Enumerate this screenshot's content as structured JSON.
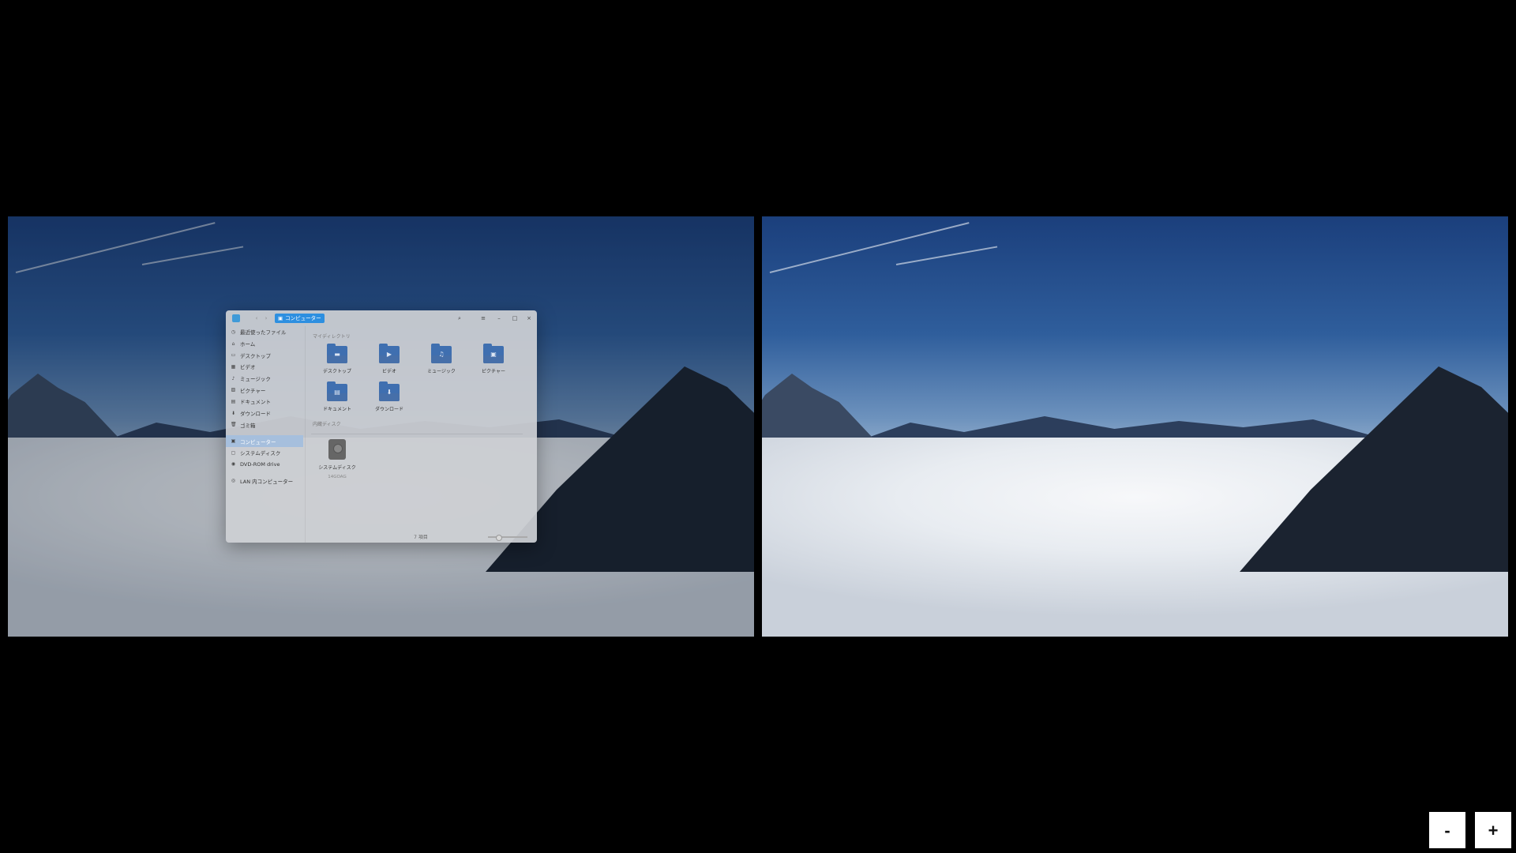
{
  "left_workspace": {
    "file_manager": {
      "title_crumb": "コンピューター",
      "sidebar": [
        {
          "icon": "clock-icon",
          "label": "最近使ったファイル"
        },
        {
          "icon": "home-icon",
          "label": "ホーム"
        },
        {
          "icon": "desktop-icon",
          "label": "デスクトップ"
        },
        {
          "icon": "video-icon",
          "label": "ビデオ"
        },
        {
          "icon": "music-icon",
          "label": "ミュージック"
        },
        {
          "icon": "picture-icon",
          "label": "ピクチャー"
        },
        {
          "icon": "document-icon",
          "label": "ドキュメント"
        },
        {
          "icon": "download-icon",
          "label": "ダウンロード"
        },
        {
          "icon": "trash-icon",
          "label": "ゴミ箱"
        },
        {
          "icon": "computer-icon",
          "label": "コンピューター"
        },
        {
          "icon": "disk-icon",
          "label": "システムディスク"
        },
        {
          "icon": "dvd-icon",
          "label": "DVD-ROM drive"
        },
        {
          "icon": "network-icon",
          "label": "LAN 内コンピューター"
        }
      ],
      "my_dirs_title": "マイディレクトリ",
      "folders": [
        {
          "icon": "desktop-folder-icon",
          "glyph": "▬",
          "label": "デスクトップ"
        },
        {
          "icon": "video-folder-icon",
          "glyph": "▶",
          "label": "ビデオ"
        },
        {
          "icon": "music-folder-icon",
          "glyph": "♫",
          "label": "ミュージック"
        },
        {
          "icon": "picture-folder-icon",
          "glyph": "▣",
          "label": "ピクチャー"
        },
        {
          "icon": "document-folder-icon",
          "glyph": "▤",
          "label": "ドキュメント"
        },
        {
          "icon": "download-folder-icon",
          "glyph": "⬇",
          "label": "ダウンロード"
        }
      ],
      "internal_disk_title": "内蔵ディスク",
      "disk": {
        "label": "システムディスク",
        "size": "14GOAG"
      },
      "status": "7 項目"
    }
  },
  "zoom_controls": {
    "minus": "-",
    "plus": "+"
  },
  "colors": {
    "accent": "#2d8fe0",
    "background": "#000000"
  }
}
